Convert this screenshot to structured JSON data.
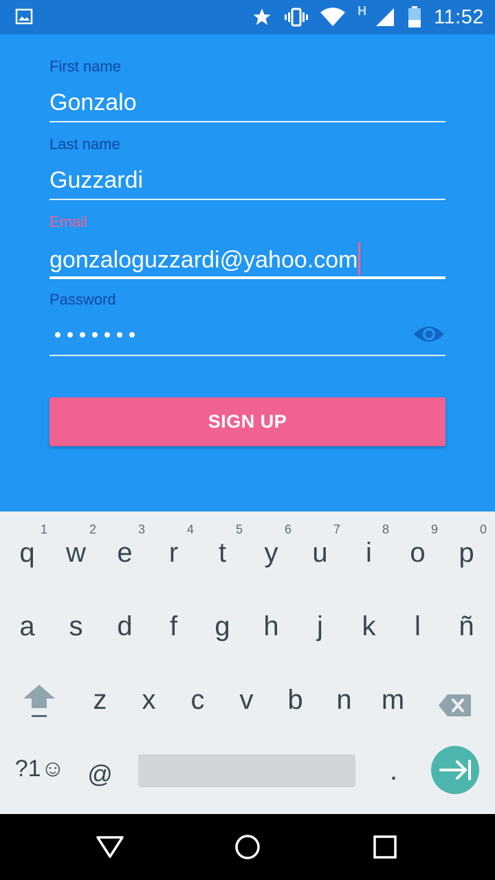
{
  "status_bar": {
    "time": "11:52",
    "network_type": "H",
    "icons": [
      "image-icon",
      "star-icon",
      "vibrate-icon",
      "wifi-icon",
      "signal-icon",
      "battery-icon"
    ]
  },
  "form": {
    "first_name": {
      "label": "First name",
      "value": "Gonzalo"
    },
    "last_name": {
      "label": "Last name",
      "value": "Guzzardi"
    },
    "email": {
      "label": "Email",
      "value": "gonzaloguzzardi@yahoo.com"
    },
    "password": {
      "label": "Password",
      "masked_length": 7
    }
  },
  "signup_button": {
    "label": "SIGN UP"
  },
  "keyboard": {
    "row1": [
      {
        "k": "q",
        "n": "1"
      },
      {
        "k": "w",
        "n": "2"
      },
      {
        "k": "e",
        "n": "3"
      },
      {
        "k": "r",
        "n": "4"
      },
      {
        "k": "t",
        "n": "5"
      },
      {
        "k": "y",
        "n": "6"
      },
      {
        "k": "u",
        "n": "7"
      },
      {
        "k": "i",
        "n": "8"
      },
      {
        "k": "o",
        "n": "9"
      },
      {
        "k": "p",
        "n": "0"
      }
    ],
    "row2": [
      "a",
      "s",
      "d",
      "f",
      "g",
      "h",
      "j",
      "k",
      "l",
      "ñ"
    ],
    "row3": [
      "z",
      "x",
      "c",
      "v",
      "b",
      "n",
      "m"
    ],
    "symbols_key": "?1☺",
    "at_key": "@",
    "period_key": "."
  },
  "colors": {
    "background": "#2196F3",
    "status_bar": "#1976D2",
    "accent": "#F06292",
    "label": "#0D47A1",
    "enter_key": "#4DB6AC"
  }
}
